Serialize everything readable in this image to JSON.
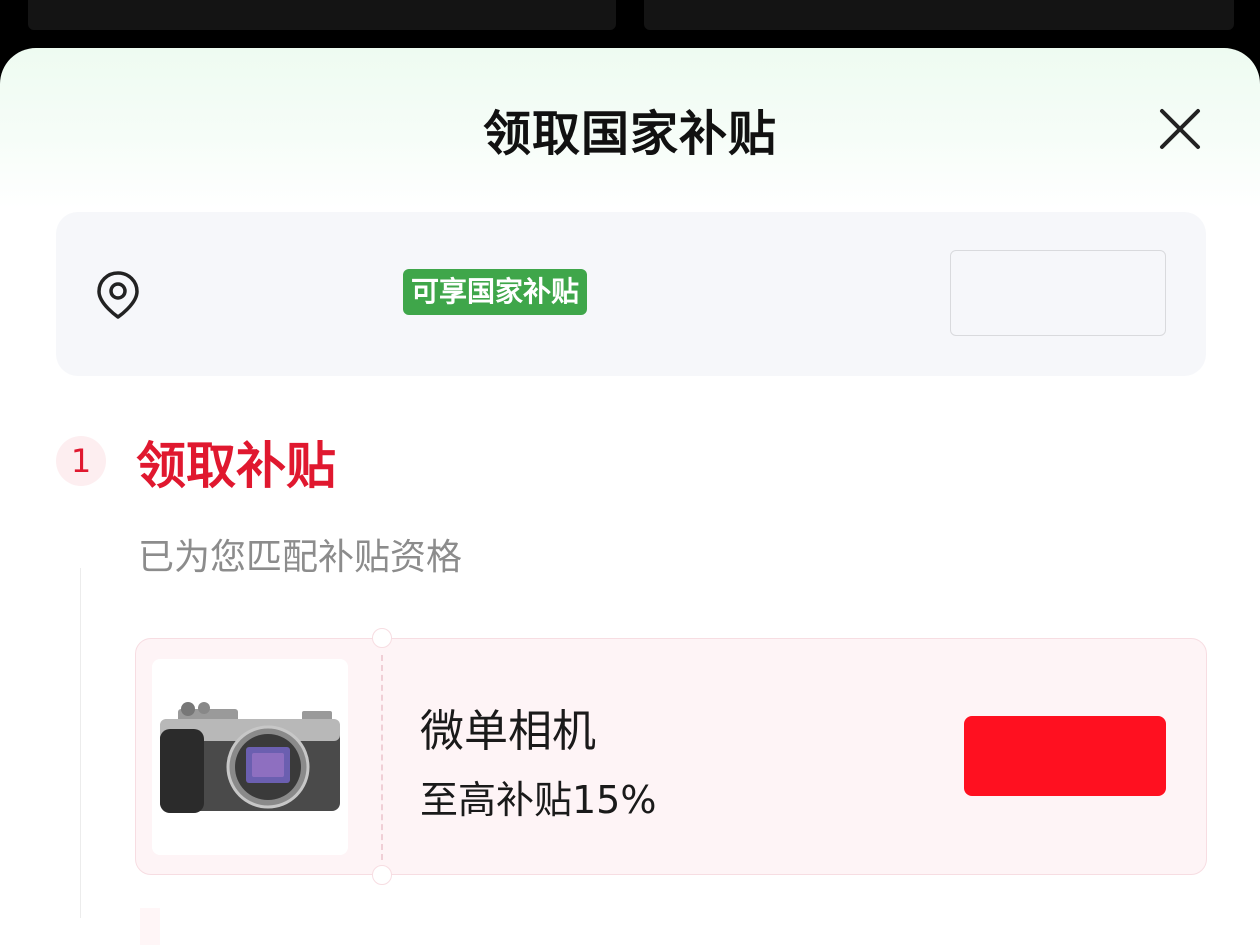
{
  "sheet": {
    "title": "领取国家补贴",
    "close_icon": "close-icon"
  },
  "address": {
    "location_icon": "location-pin-icon",
    "badge_label": "可享国家补贴",
    "badge_color": "#3fa64a"
  },
  "step": {
    "number": "1",
    "title": "领取补贴",
    "description": "已为您匹配补贴资格",
    "accent_color": "#e0182f"
  },
  "coupon": {
    "product_image": "camera-image",
    "product_name": "微单相机",
    "subsidy_rate": "至高补贴15%",
    "button_color": "#ff1020"
  }
}
